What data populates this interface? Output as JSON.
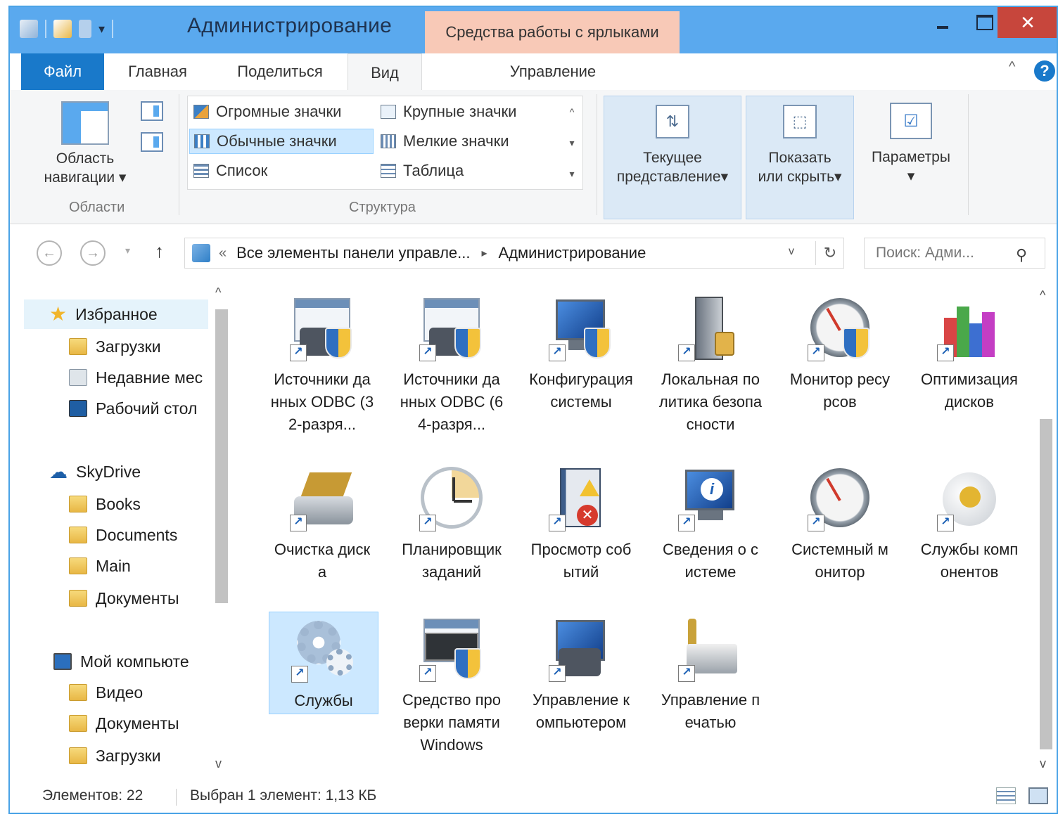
{
  "window": {
    "title": "Администрирование",
    "context_tab": "Средства работы с ярлыками",
    "close_glyph": "✕"
  },
  "ribbon_tabs": {
    "file": "Файл",
    "home": "Главная",
    "share": "Поделиться",
    "view": "Вид",
    "manage": "Управление",
    "collapse_glyph": "^",
    "help_glyph": "?"
  },
  "ribbon": {
    "nav_pane_line1": "Область",
    "nav_pane_line2": "навигации",
    "dropdown_glyph": "▾",
    "group_panes": "Области",
    "layout": {
      "huge": "Огромные значки",
      "large": "Крупные значки",
      "normal": "Обычные значки",
      "small": "Мелкие значки",
      "list": "Список",
      "table": "Таблица"
    },
    "group_layout": "Структура",
    "current_view_line1": "Текущее",
    "current_view_line2": "представление",
    "show_hide_line1": "Показать",
    "show_hide_line2": "или скрыть",
    "options": "Параметры"
  },
  "address": {
    "back": "←",
    "forward": "→",
    "up": "↑",
    "overflow": "«",
    "crumb_parent": "Все элементы панели управле...",
    "crumb_sep": "▸",
    "crumb_current": "Администрирование",
    "refresh": "↻",
    "search_placeholder": "Поиск: Адми...",
    "search_glyph": "⚲"
  },
  "nav": {
    "favorites": "Избранное",
    "downloads": "Загрузки",
    "recent": "Недавние мес",
    "desktop": "Рабочий стол",
    "skydrive": "SkyDrive",
    "books": "Books",
    "documents": "Documents",
    "main": "Main",
    "dokumenty": "Документы",
    "computer": "Мой компьюте",
    "video": "Видео",
    "pc_docs": "Документы",
    "pc_downloads": "Загрузки",
    "star_glyph": "★",
    "cloud_glyph": "☁"
  },
  "items": [
    {
      "label": "Источники данных ODBC (32-разря...",
      "icon": "odbc-icon"
    },
    {
      "label": "Источники данных ODBC (64-разря...",
      "icon": "odbc-icon"
    },
    {
      "label": "Конфигурация системы",
      "icon": "system-config-icon"
    },
    {
      "label": "Локальная политика безопасности",
      "icon": "security-policy-icon"
    },
    {
      "label": "Монитор ресурсов",
      "icon": "resource-monitor-icon"
    },
    {
      "label": "Оптимизация дисков",
      "icon": "disk-optimize-icon"
    },
    {
      "label": "Очистка диска",
      "icon": "disk-cleanup-icon"
    },
    {
      "label": "Планировщик заданий",
      "icon": "task-scheduler-icon"
    },
    {
      "label": "Просмотр событий",
      "icon": "event-viewer-icon"
    },
    {
      "label": "Сведения о системе",
      "icon": "system-info-icon"
    },
    {
      "label": "Системный монитор",
      "icon": "performance-monitor-icon"
    },
    {
      "label": "Службы компонентов",
      "icon": "component-services-icon"
    },
    {
      "label": "Службы",
      "icon": "services-icon",
      "selected": true
    },
    {
      "label": "Средство проверки памяти Windows",
      "icon": "memory-diagnostic-icon"
    },
    {
      "label": "Управление компьютером",
      "icon": "computer-management-icon"
    },
    {
      "label": "Управление печатью",
      "icon": "print-management-icon"
    }
  ],
  "shortcut_glyph": "↗",
  "error_glyph": "✕",
  "info_glyph": "i",
  "status": {
    "count": "Элементов: 22",
    "selection": "Выбран 1 элемент: 1,13 КБ"
  },
  "scroll": {
    "up": "^",
    "down": "v"
  },
  "colors": {
    "titlebar": "#5aa9ee",
    "file_tab": "#1979ca",
    "context_tab": "#f8c9b7",
    "close_button": "#c7463c",
    "selection": "#cce8ff"
  }
}
